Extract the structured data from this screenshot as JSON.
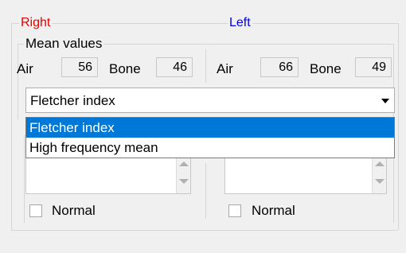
{
  "sections": {
    "right_label": "Right",
    "left_label": "Left",
    "right_color": "#e60000",
    "left_color": "#0000e6"
  },
  "mean_values": {
    "title": "Mean values",
    "right": {
      "air_label": "Air",
      "air_value": "56",
      "bone_label": "Bone",
      "bone_value": "46"
    },
    "left": {
      "air_label": "Air",
      "air_value": "66",
      "bone_label": "Bone",
      "bone_value": "49"
    }
  },
  "index_select": {
    "selected": "Fletcher index",
    "options": [
      "Fletcher index",
      "High frequency mean"
    ],
    "highlight_color": "#0078d7"
  },
  "normal": {
    "right_label": "Normal",
    "left_label": "Normal"
  }
}
